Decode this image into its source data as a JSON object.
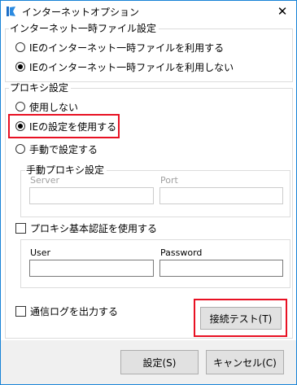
{
  "window": {
    "title": "インターネットオプション",
    "close_label": "✕"
  },
  "temp_files": {
    "legend": "インターネット一時ファイル設定",
    "options": [
      {
        "label": "IEのインターネット一時ファイルを利用する",
        "selected": false
      },
      {
        "label": "IEのインターネット一時ファイルを利用しない",
        "selected": true
      }
    ]
  },
  "proxy": {
    "legend": "プロキシ設定",
    "options": [
      {
        "label": "使用しない",
        "selected": false
      },
      {
        "label": "IEの設定を使用する",
        "selected": true
      },
      {
        "label": "手動で設定する",
        "selected": false
      }
    ],
    "manual": {
      "legend": "手動プロキシ設定",
      "server_label": "Server",
      "server_value": "",
      "port_label": "Port",
      "port_value": ""
    },
    "auth": {
      "label": "プロキシ基本認証を使用する",
      "checked": false,
      "user_label": "User",
      "user_value": "",
      "password_label": "Password",
      "password_value": ""
    }
  },
  "log": {
    "label": "通信ログを出力する",
    "checked": false
  },
  "buttons": {
    "test": "接続テスト(T)",
    "ok": "設定(S)",
    "cancel": "キャンセル(C)"
  },
  "colors": {
    "highlight": "#e81123",
    "title_border": "#1883d7"
  }
}
